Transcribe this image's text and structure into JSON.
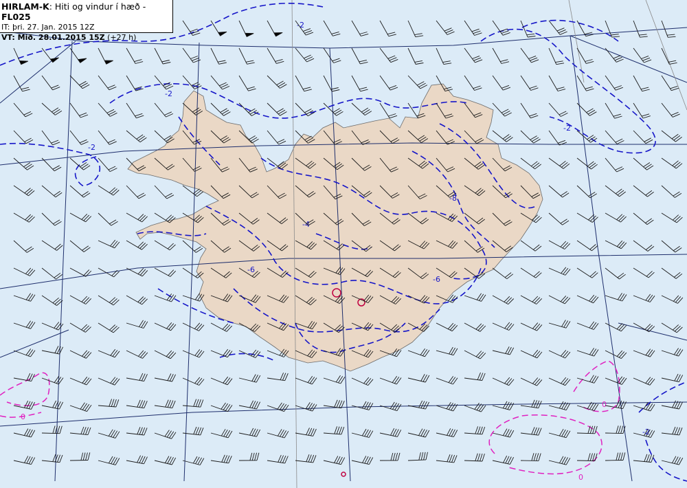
{
  "colors": {
    "sea": "#dcebf7",
    "land": "#ead8c6",
    "coast": "#6b6b6b",
    "grid": "#1d2d6b",
    "meridian": "#8a8a8a",
    "contour_cold": "#1515c8",
    "contour_zero": "#e020c0",
    "contour_warm": "#c00040",
    "barb": "#1a1a1a"
  },
  "legend": {
    "model": "HIRLAM-K",
    "desc": ": Hiti og vindur í hæð - ",
    "level": "FL025",
    "it_line": "IT: þri. 27. Jan. 2015 12Z",
    "vt_prefix": "VT: Mið. 28.01.2015 15Z",
    "vt_suffix": " (+27 h)"
  },
  "contour_labels": [
    {
      "text": "-2",
      "color": "contour_cold"
    },
    {
      "text": "-4",
      "color": "contour_cold"
    },
    {
      "text": "-6",
      "color": "contour_cold"
    },
    {
      "text": "-8",
      "color": "contour_cold"
    },
    {
      "text": "0",
      "color": "contour_zero"
    }
  ],
  "barb_icon": "wind-barb-icon"
}
